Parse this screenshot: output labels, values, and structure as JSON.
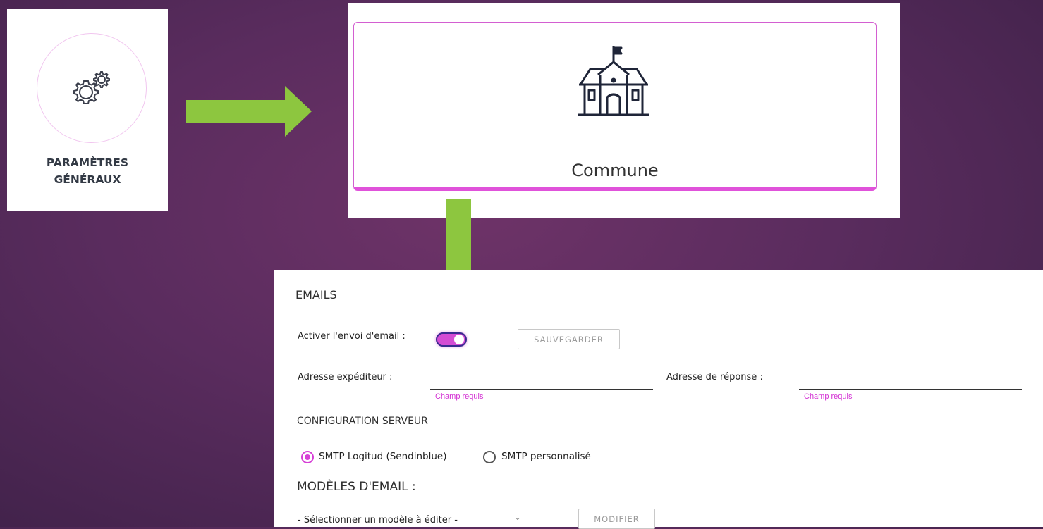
{
  "settings_card": {
    "title_line1": "PARAMÈTRES",
    "title_line2": "GÉNÉRAUX",
    "icon": "gears-icon"
  },
  "commune_card": {
    "label": "Commune",
    "icon": "town-hall-icon"
  },
  "emails": {
    "title": "EMAILS",
    "enable_label": "Activer l'envoi d'email :",
    "enable_on": true,
    "save_button": "SAUVEGARDER",
    "sender_label": "Adresse expéditeur :",
    "sender_value": "",
    "sender_required": "Champ requis",
    "reply_label": "Adresse de réponse :",
    "reply_value": "",
    "reply_required": "Champ requis",
    "server_title": "CONFIGURATION SERVEUR",
    "smtp_options": [
      {
        "label": "SMTP Logitud (Sendinblue)",
        "selected": true
      },
      {
        "label": "SMTP personnalisé",
        "selected": false
      }
    ],
    "templates_title": "MODÈLES D'EMAIL :",
    "template_select": "- Sélectionner un modèle à éditer -",
    "modify_button": "MODIFIER"
  },
  "colors": {
    "accent": "#d63fd6",
    "arrow": "#8dc63f",
    "background": "#5a2c5e"
  }
}
